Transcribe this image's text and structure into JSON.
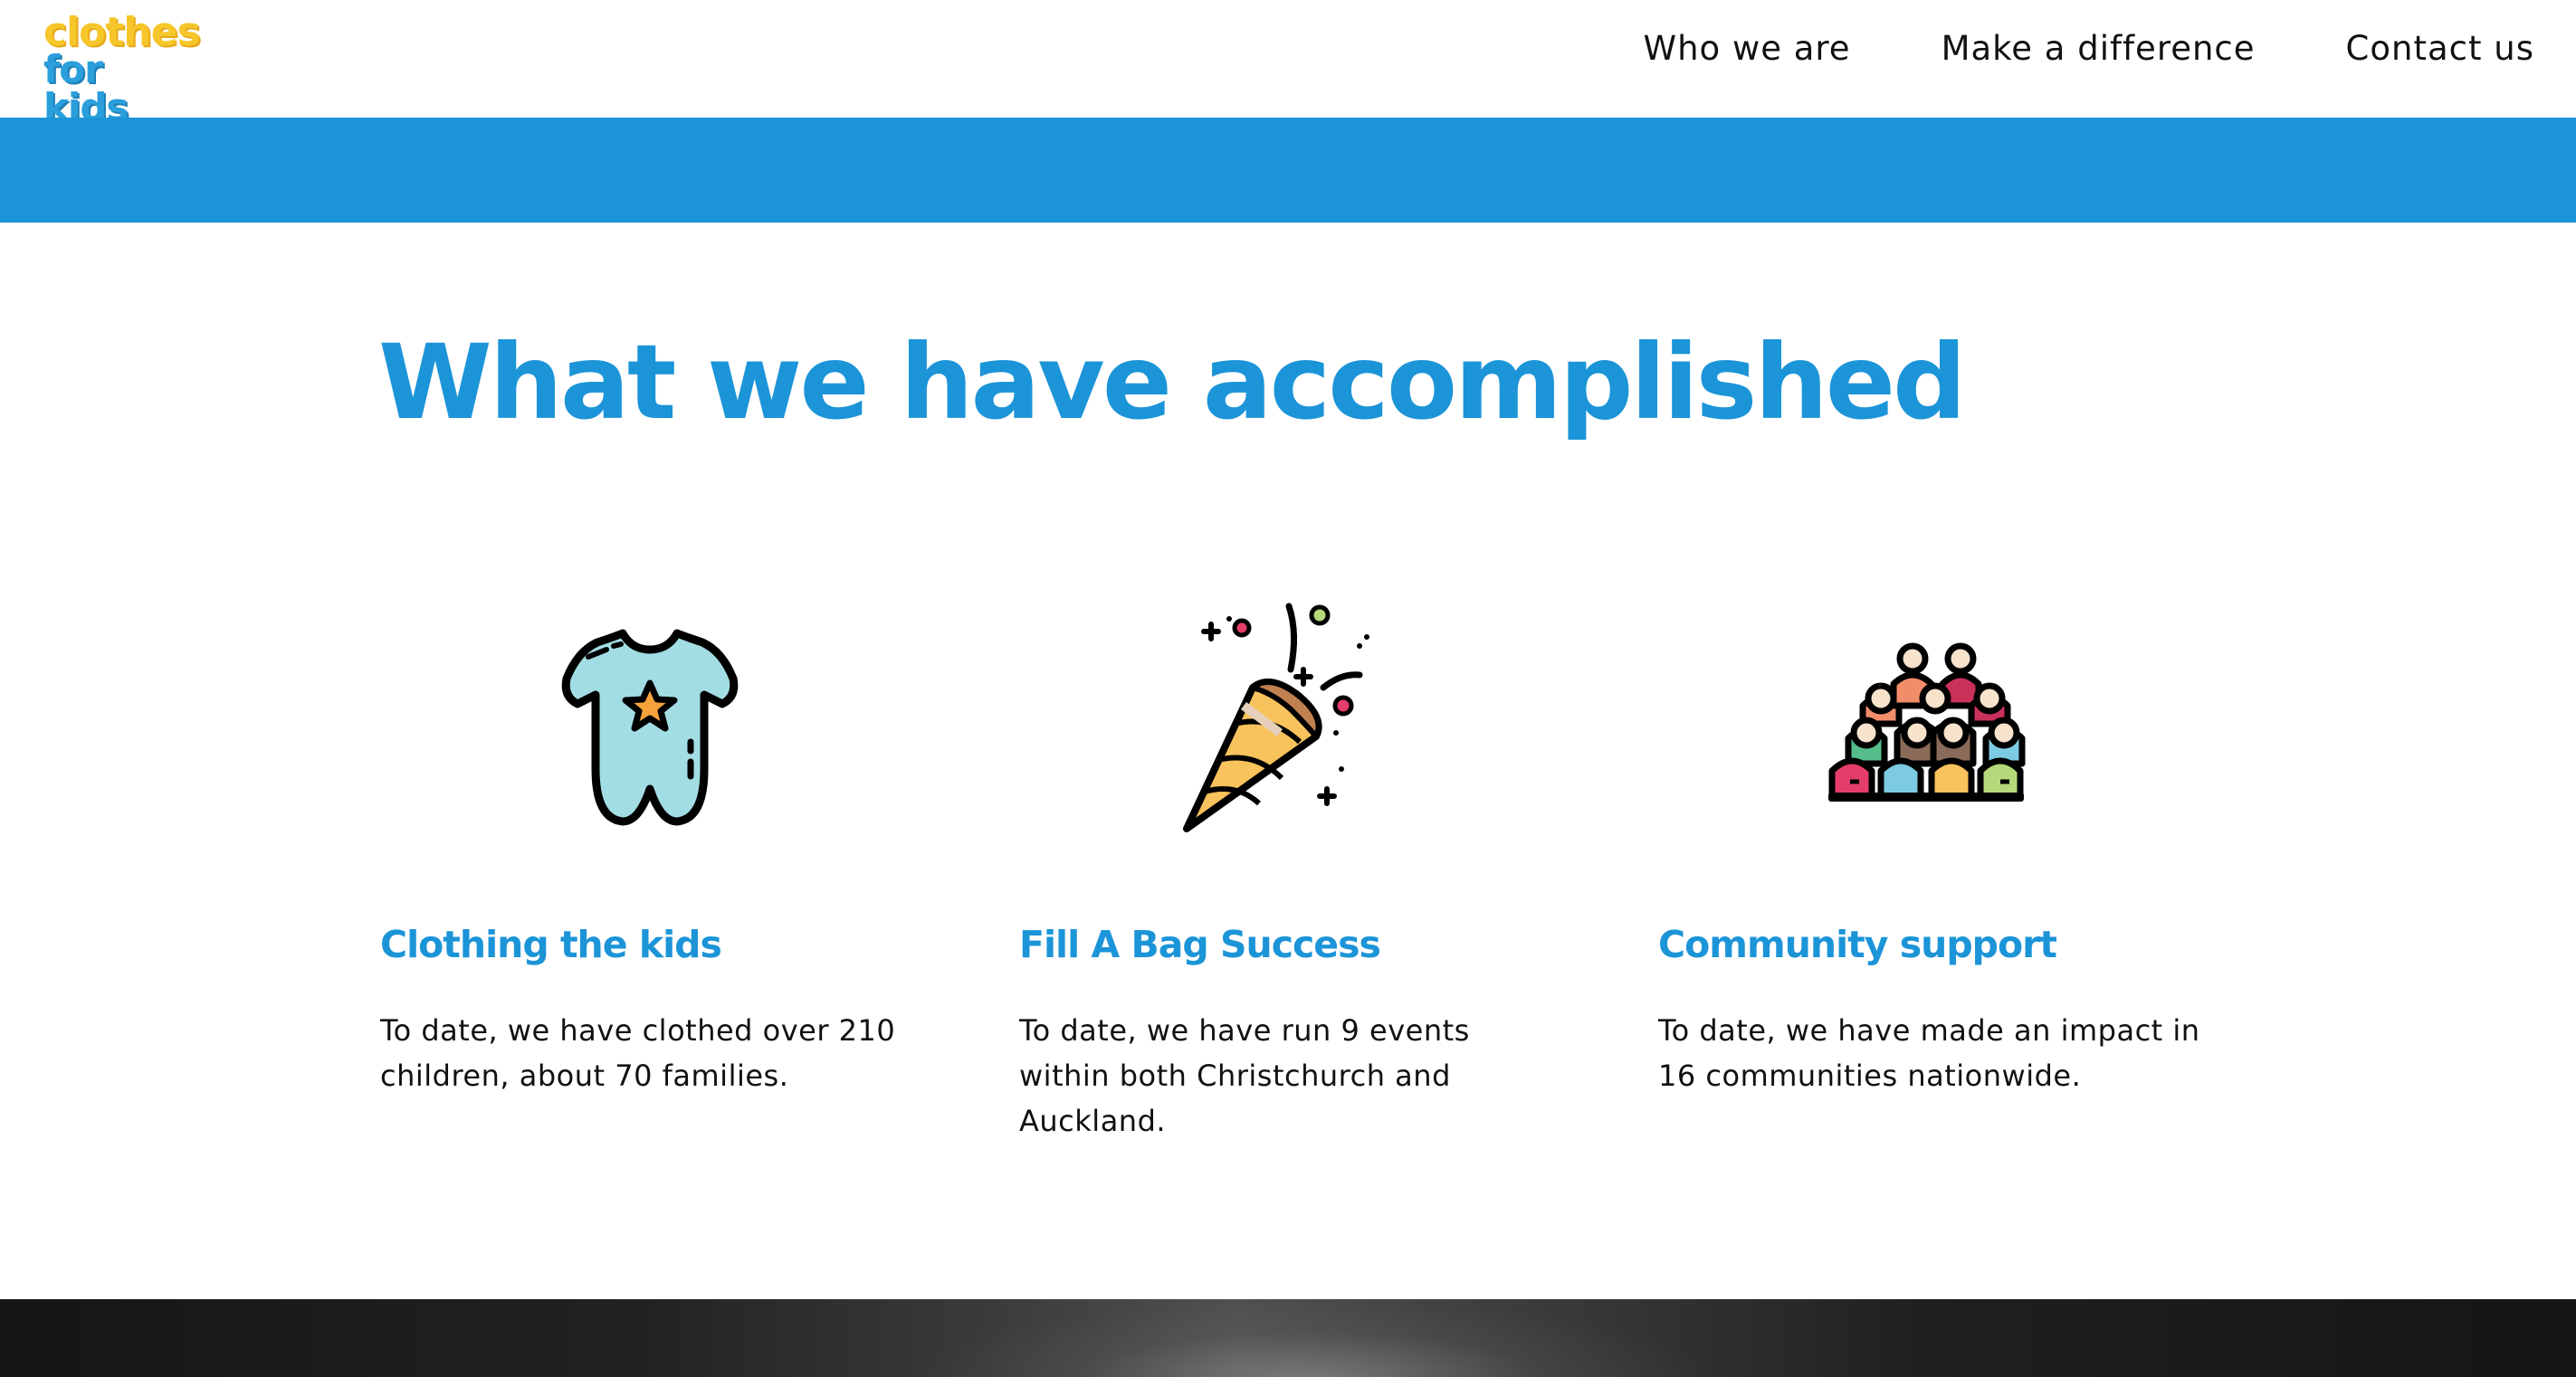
{
  "header": {
    "logo_line1": "clothes",
    "logo_line2": "for kids",
    "nav": [
      {
        "label": "Who we are"
      },
      {
        "label": "Make a difference"
      },
      {
        "label": "Contact us"
      }
    ]
  },
  "main": {
    "title": "What we have accomplished",
    "features": [
      {
        "icon": "baby-onesie-icon",
        "title": "Clothing the kids",
        "text": "To date, we have clothed over 210 children, about 70 families."
      },
      {
        "icon": "party-popper-icon",
        "title": "Fill A Bag Success",
        "text": "To date, we have run 9 events within both Christchurch and Auckland."
      },
      {
        "icon": "community-group-icon",
        "title": "Community support",
        "text": "To date, we have made an impact in 16 communities nationwide."
      }
    ]
  },
  "colors": {
    "brand_blue": "#1c94d8",
    "logo_yellow": "#f6c62a",
    "logo_blue": "#2a9fdc"
  }
}
